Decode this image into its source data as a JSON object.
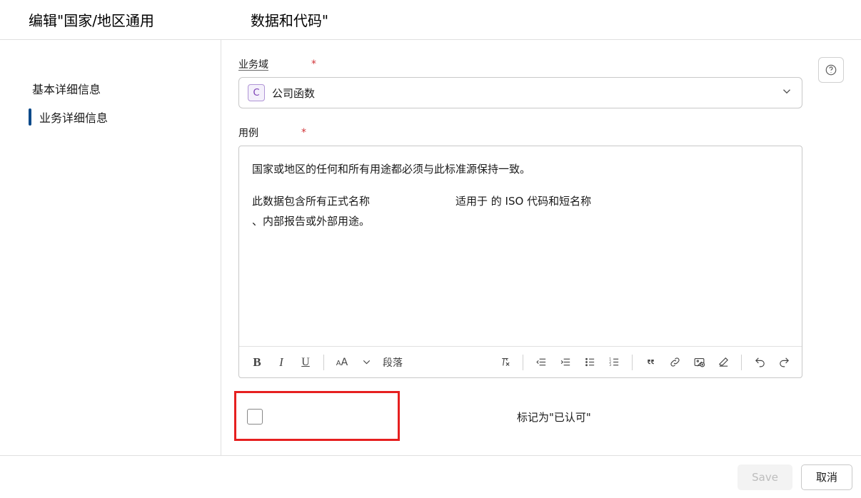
{
  "header": {
    "title_prefix": "编辑\"国家/地区通用",
    "title_suffix": "数据和代码\""
  },
  "sidebar": {
    "items": [
      {
        "label": "基本详细信息",
        "active": false
      },
      {
        "label": "业务详细信息",
        "active": true
      }
    ]
  },
  "fields": {
    "business_domain": {
      "label": "业务域",
      "chip": "C",
      "value": "公司函数"
    },
    "use_case": {
      "label": "用例",
      "para1": "国家或地区的任何和所有用途都必须与此标准源保持一致。",
      "para2a": "此数据包含所有正式名称",
      "para2b": "适用于 的 ISO 代码和短名称",
      "para3": "、内部报告或外部用途。"
    },
    "endorsed": {
      "label": "标记为\"已认可\""
    }
  },
  "toolbar": {
    "font_label": "A",
    "font_small": "A",
    "paragraph": "段落"
  },
  "footer": {
    "save": "Save",
    "cancel": "取消"
  }
}
